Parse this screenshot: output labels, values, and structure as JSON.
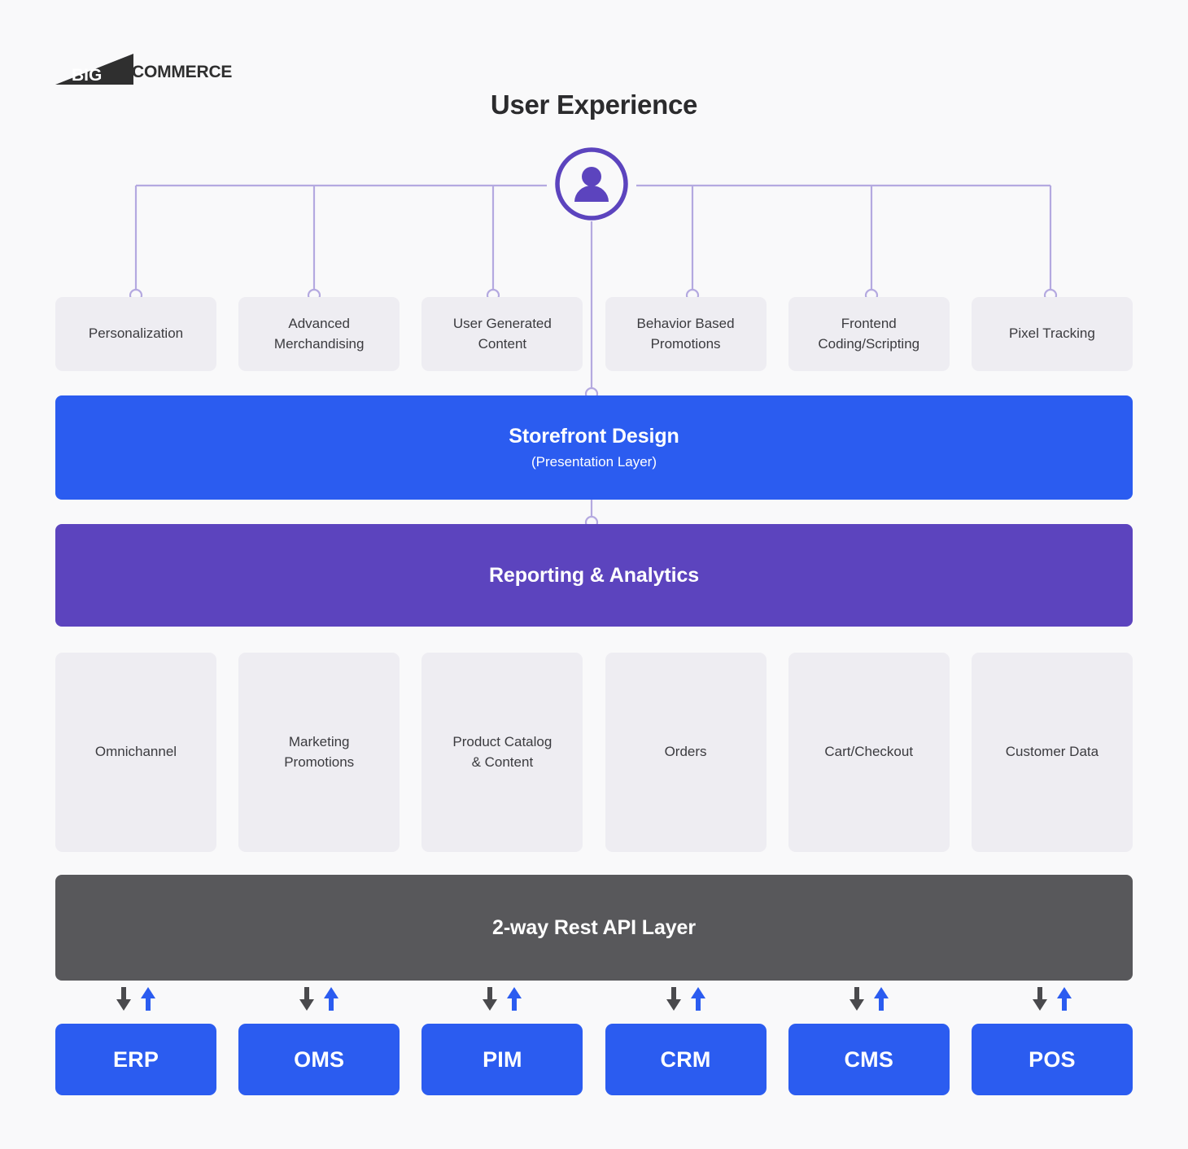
{
  "brand": {
    "logo_text": "COMMERCE",
    "logo_mark_text": "BIG",
    "logo_name": "bigcommerce-logo"
  },
  "header": {
    "title": "User Experience",
    "user_icon": "user-avatar-icon"
  },
  "colors": {
    "background": "#F9F9FA",
    "blue": "#2B5CF0",
    "purple": "#5C44BE",
    "gray_bar": "#58585B",
    "box_gray": "#EEEDF2",
    "connector": "#B4A9E0",
    "text_dark": "#3B3B3F",
    "arrow_down": "#4A4A4D",
    "arrow_up": "#2B5CF0"
  },
  "ux_features": [
    {
      "label": "Personalization"
    },
    {
      "label": "Advanced\nMerchandising"
    },
    {
      "label": "User Generated\nContent"
    },
    {
      "label": "Behavior Based\nPromotions"
    },
    {
      "label": "Frontend\nCoding/Scripting"
    },
    {
      "label": "Pixel Tracking"
    }
  ],
  "storefront": {
    "title": "Storefront Design",
    "subtitle": "(Presentation Layer)"
  },
  "reporting": {
    "title": "Reporting & Analytics"
  },
  "platform_modules": [
    {
      "label": "Omnichannel"
    },
    {
      "label": "Marketing\nPromotions"
    },
    {
      "label": "Product Catalog\n& Content"
    },
    {
      "label": "Orders"
    },
    {
      "label": "Cart/Checkout"
    },
    {
      "label": "Customer Data"
    }
  ],
  "api_layer": {
    "title": "2-way Rest API Layer",
    "arrow_down_icon": "arrow-down-icon",
    "arrow_up_icon": "arrow-up-icon"
  },
  "integrations": [
    {
      "label": "ERP"
    },
    {
      "label": "OMS"
    },
    {
      "label": "PIM"
    },
    {
      "label": "CRM"
    },
    {
      "label": "CMS"
    },
    {
      "label": "POS"
    }
  ]
}
